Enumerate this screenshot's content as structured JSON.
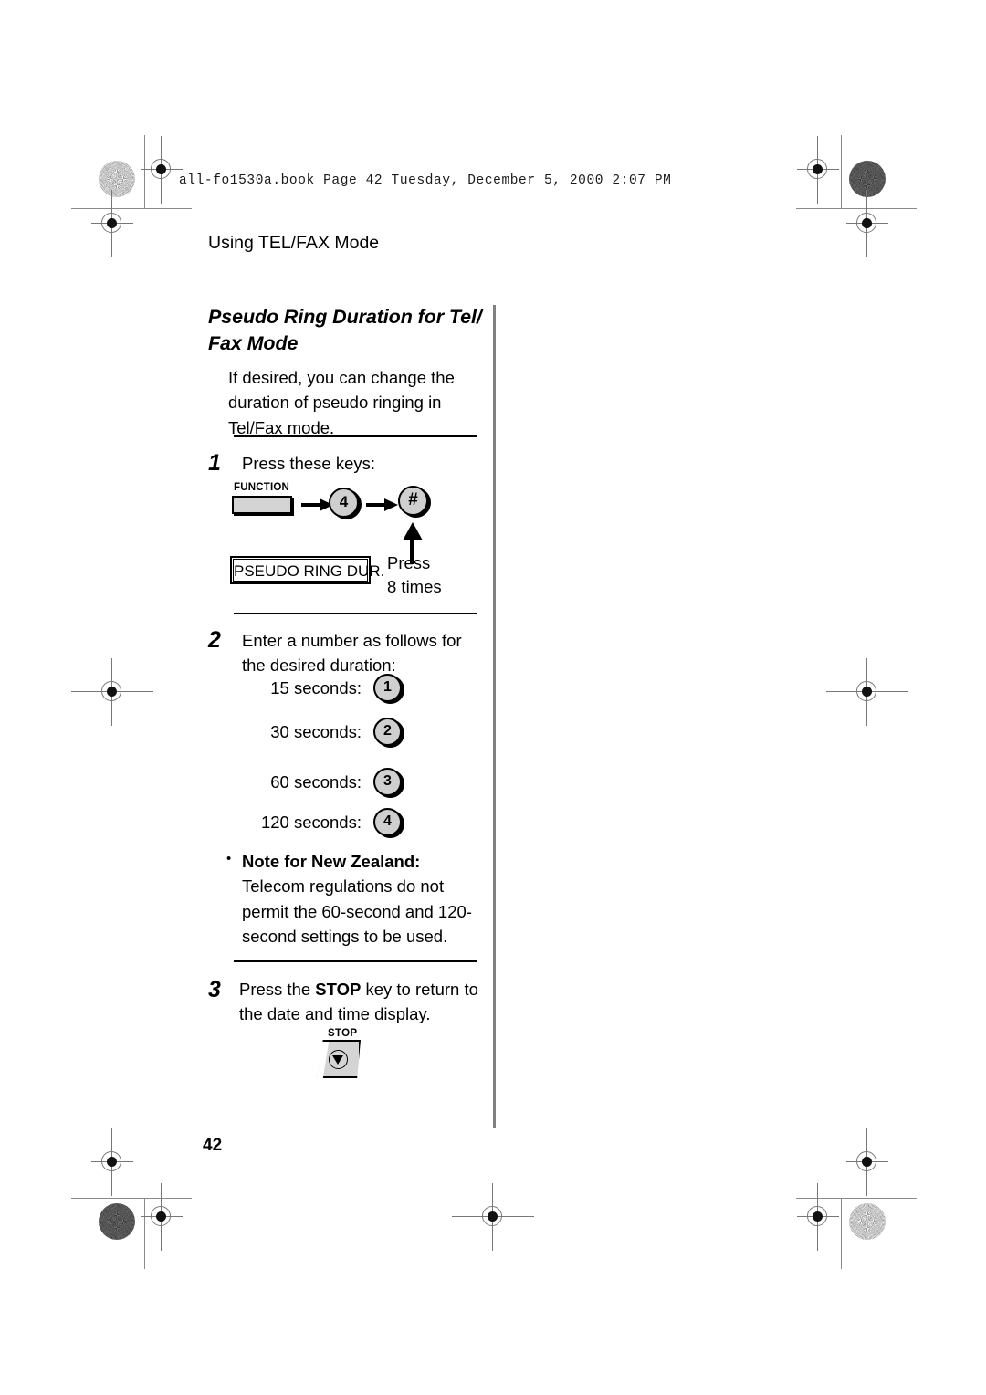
{
  "slug": "all-fo1530a.book  Page 42  Tuesday, December 5, 2000  2:07 PM",
  "running_head": "Using TEL/FAX Mode",
  "section_title": "Pseudo Ring Duration for Tel/ Fax Mode",
  "intro": "If desired, you can change the duration of pseudo ringing in Tel/Fax mode.",
  "steps": [
    {
      "number": "1",
      "text": "Press these keys:"
    },
    {
      "number": "2",
      "text": "Enter a number as follows for the desired duration:"
    },
    {
      "number": "3",
      "text_before": "Press the ",
      "bold": "STOP",
      "text_after": " key to return to the date and time display."
    }
  ],
  "key_sequence": {
    "function_label": "FUNCTION",
    "key_4": "4",
    "key_hash": "#",
    "press_line1": "Press",
    "press_line2": "8 times",
    "display_text": "PSEUDO RING DUR.",
    "arrow_right_icon": "arrow-right-icon",
    "arrow_up_icon": "arrow-up-icon"
  },
  "durations": [
    {
      "label": "15 seconds:",
      "key": "1"
    },
    {
      "label": "30 seconds:",
      "key": "2"
    },
    {
      "label": "60 seconds:",
      "key": "3"
    },
    {
      "label": "120 seconds:",
      "key": "4"
    }
  ],
  "note": {
    "bullet": "•",
    "bold": "Note for New Zealand:",
    "text": " Telecom regulations do not permit the 60-second and 120-second settings to be used."
  },
  "stop_key": {
    "label": "STOP",
    "glyph": "stop-triangle-icon"
  },
  "folio": "42",
  "colors": {
    "key_fill": "#cfcfcf",
    "function_fill": "#d4d4d4",
    "rule": "#000000",
    "divider": "#808080",
    "mark": "#777777"
  }
}
